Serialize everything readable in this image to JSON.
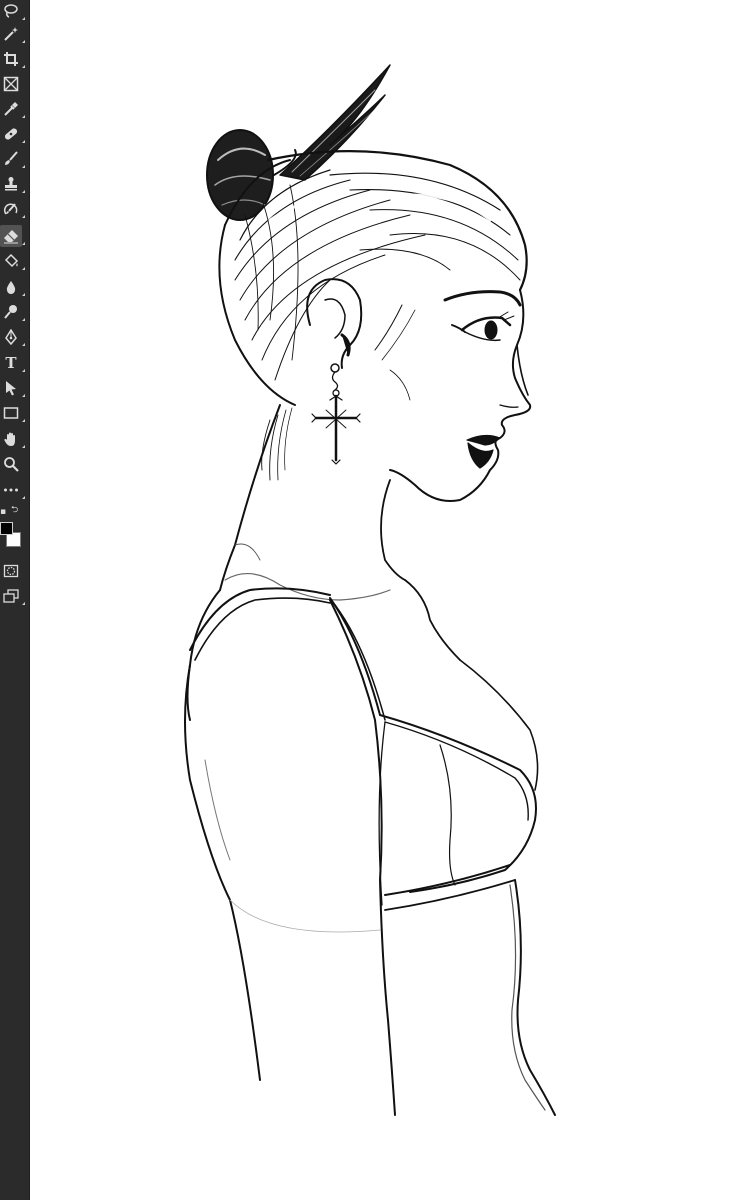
{
  "app": {
    "toolbar": {
      "tools": [
        {
          "name": "lasso-tool",
          "icon": "lasso-icon"
        },
        {
          "name": "magic-wand-tool",
          "icon": "magic-wand-icon"
        },
        {
          "name": "crop-tool",
          "icon": "crop-icon"
        },
        {
          "name": "frame-tool",
          "icon": "frame-icon"
        },
        {
          "name": "eyedropper-tool",
          "icon": "eyedropper-icon"
        },
        {
          "name": "healing-brush-tool",
          "icon": "bandage-icon"
        },
        {
          "name": "brush-tool",
          "icon": "brush-icon"
        },
        {
          "name": "clone-stamp-tool",
          "icon": "stamp-icon"
        },
        {
          "name": "history-brush-tool",
          "icon": "history-brush-icon"
        },
        {
          "name": "eraser-tool",
          "icon": "eraser-icon",
          "active": true
        },
        {
          "name": "paint-bucket-tool",
          "icon": "paint-bucket-icon"
        },
        {
          "name": "blur-tool",
          "icon": "droplet-icon"
        },
        {
          "name": "dodge-tool",
          "icon": "dodge-icon"
        },
        {
          "name": "pen-tool",
          "icon": "pen-nib-icon"
        },
        {
          "name": "type-tool",
          "icon": "type-icon",
          "label": "T"
        },
        {
          "name": "path-selection-tool",
          "icon": "arrow-cursor-icon"
        },
        {
          "name": "rectangle-tool",
          "icon": "rectangle-icon"
        },
        {
          "name": "hand-tool",
          "icon": "hand-icon"
        },
        {
          "name": "zoom-tool",
          "icon": "magnifier-icon"
        },
        {
          "name": "edit-toolbar",
          "icon": "ellipsis-icon"
        }
      ]
    },
    "colors": {
      "toolbar_bg": "#2b2b2b",
      "foreground": "#000000",
      "background": "#ffffff",
      "icon": "#dcdcdc"
    }
  }
}
